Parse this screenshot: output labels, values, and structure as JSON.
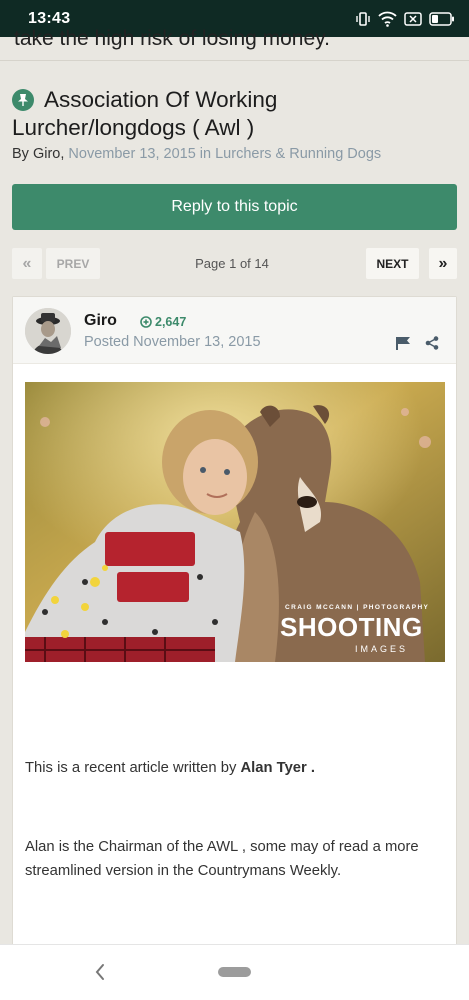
{
  "status_bar": {
    "time": "13:43"
  },
  "previous_text_tail": "take the high risk of losing money.",
  "topic": {
    "title_line1": "Association Of Working",
    "title_line2": "Lurcher/longdogs ( Awl )",
    "by_prefix": "By",
    "author": "Giro,",
    "date_and_forum": "November 13, 2015 in Lurchers & Running Dogs"
  },
  "reply_button": "Reply to this topic",
  "pagination": {
    "first": "«",
    "prev": "PREV",
    "page_info": "Page 1 of 14",
    "next": "NEXT",
    "last": "»"
  },
  "post": {
    "author": "Giro",
    "reputation": "2,647",
    "posted": "Posted November 13, 2015",
    "watermark": {
      "line1": "CRAIG MCCANN | PHOTOGRAPHY",
      "line2": "SHOOTING",
      "line3": "IMAGES"
    },
    "para1_prefix": "This is a recent article written by ",
    "para1_name": "Alan Tyer .",
    "para2": "Alan is the Chairman of the AWL , some may of read a more streamlined version in the Countrymans Weekly."
  },
  "colors": {
    "accent": "#3d8a6b",
    "status_bar": "#0f2a24",
    "muted_text": "#8a9aa6",
    "page_bg": "#e9e7e1"
  },
  "icons": {
    "pin": "pin-icon",
    "rep": "plus-circle-icon",
    "flag": "flag-icon",
    "share": "share-icon",
    "back": "chevron-left-icon"
  }
}
